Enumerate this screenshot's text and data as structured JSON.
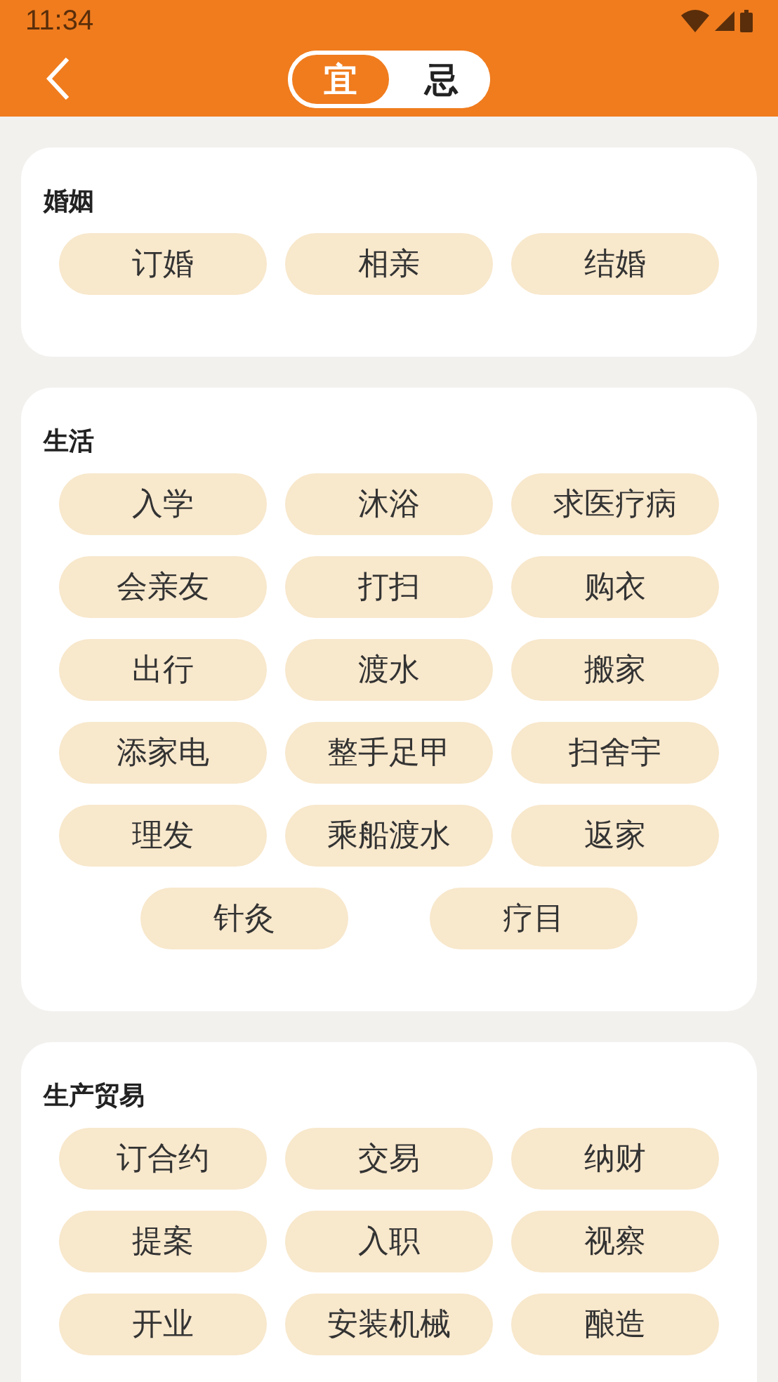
{
  "status_bar": {
    "time": "11:34"
  },
  "toggle": [
    {
      "label": "宜",
      "selected": true
    },
    {
      "label": "忌",
      "selected": false
    }
  ],
  "sections": [
    {
      "title": "婚姻",
      "items": [
        "订婚",
        "相亲",
        "结婚"
      ]
    },
    {
      "title": "生活",
      "items": [
        "入学",
        "沐浴",
        "求医疗病",
        "会亲友",
        "打扫",
        "购衣",
        "出行",
        "渡水",
        "搬家",
        "添家电",
        "整手足甲",
        "扫舍宇",
        "理发",
        "乘船渡水",
        "返家",
        "针灸",
        "疗目"
      ]
    },
    {
      "title": "生产贸易",
      "items": [
        "订合约",
        "交易",
        "纳财",
        "提案",
        "入职",
        "视察",
        "开业",
        "安装机械",
        "酿造"
      ]
    }
  ]
}
